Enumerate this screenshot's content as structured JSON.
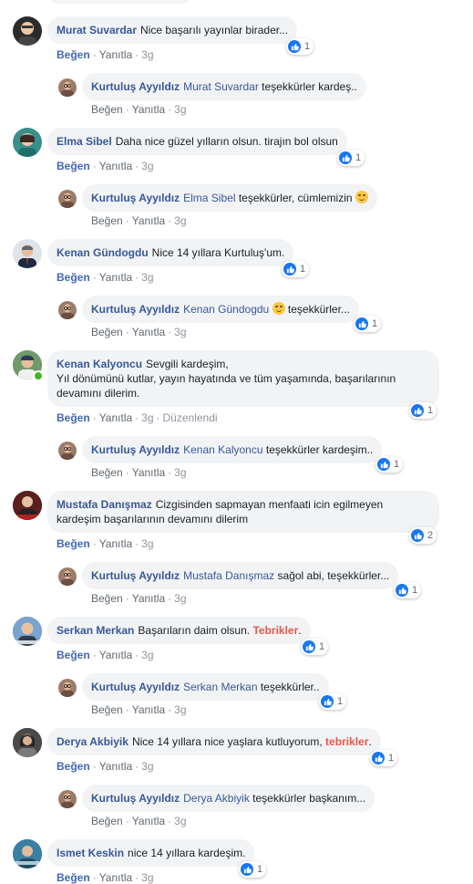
{
  "labels": {
    "like": "Beğen",
    "reply": "Yanıtla",
    "age": "3g",
    "edited": "Düzenlendi",
    "sep": "·"
  },
  "comments": [
    {
      "author": "Murat Suvardar",
      "text": "Nice başarılı yayınlar birader...",
      "reactions": "1",
      "reply": {
        "author": "Kurtuluş Ayyıldız",
        "tag": "Murat Suvardar",
        "text": "teşekkürler kardeş.."
      }
    },
    {
      "author": "Elma Sibel",
      "text": "Daha nice güzel yılların olsun. tirajın bol olsun",
      "reactions": "1",
      "reply": {
        "author": "Kurtuluş Ayyıldız",
        "tag": "Elma Sibel",
        "text": "teşekkürler, cümlemizin"
      }
    },
    {
      "author": "Kenan Gündogdu",
      "text": "Nice 14 yıllara Kurtuluş'um.",
      "reactions": "1",
      "reply": {
        "author": "Kurtuluş Ayyıldız",
        "tag": "Kenan Gündogdu",
        "text": "teşekkürler...",
        "reactions": "1"
      }
    },
    {
      "author": "Kenan Kalyoncu",
      "text": "Sevgili kardeşim,\nYıl dönümünü kutlar, yayın hayatında ve tüm yaşamında, başarılarının devamını dilerim.",
      "reactions": "1",
      "reply": {
        "author": "Kurtuluş Ayyıldız",
        "tag": "Kenan Kalyoncu",
        "text": "teşekkürler kardeşim..",
        "reactions": "1"
      }
    },
    {
      "author": "Mustafa Danışmaz",
      "text": "Cizgisinden sapmayan menfaati icin egilmeyen kardeşim başarılarının devamını dilerim",
      "reactions": "2",
      "reply": {
        "author": "Kurtuluş Ayyıldız",
        "tag": "Mustafa Danışmaz",
        "text": "sağol abi, teşekkürler...",
        "reactions": "1"
      }
    },
    {
      "author": "Serkan Merkan",
      "text": "Başarıların daim olsun.",
      "highlight": "Tebrikler",
      "reactions": "1",
      "reply": {
        "author": "Kurtuluş Ayyıldız",
        "tag": "Serkan Merkan",
        "text": "teşekkürler..",
        "reactions": "1"
      }
    },
    {
      "author": "Derya Akbiyik",
      "text": "Nice 14 yıllara nice yaşlara kutluyorum,",
      "highlight": "tebrikler",
      "reactions": "1",
      "reply": {
        "author": "Kurtuluş Ayyıldız",
        "tag": "Derya Akbiyik",
        "text": "teşekkürler başkanım..."
      }
    },
    {
      "author": "Ismet Keskin",
      "text": "nice 14 yıllara kardeşim.",
      "reactions": "1"
    }
  ],
  "colors": {
    "link": "#385898",
    "bubble": "#f2f3f5",
    "like_blue": "#4267b2",
    "highlight": "#e4574c",
    "thumb": "#1877f2"
  },
  "icons": {
    "reaction": "thumbs-up-icon",
    "emoji": "smiling-face-icon",
    "online": "online-dot-icon"
  }
}
